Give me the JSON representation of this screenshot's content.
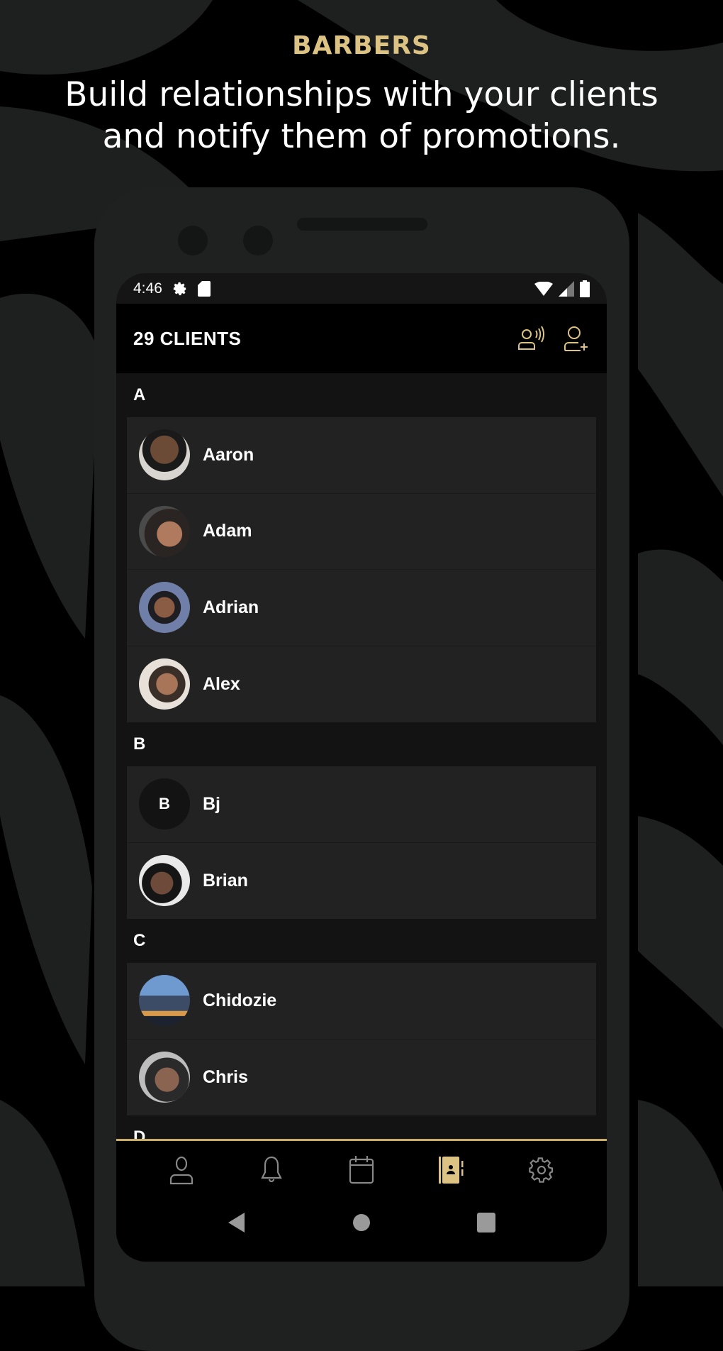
{
  "promo": {
    "tag": "BARBERS",
    "headline_line1": "Build relationships with your clients",
    "headline_line2": "and notify them of promotions."
  },
  "colors": {
    "accent": "#dcc383",
    "background": "#1e1f1f",
    "card": "#222222",
    "section": "#131313"
  },
  "status": {
    "time": "4:46",
    "icons": [
      "gear-icon",
      "sd-card-icon",
      "wifi-icon",
      "signal-icon",
      "battery-icon"
    ]
  },
  "appbar": {
    "title": "29 CLIENTS",
    "actions": [
      "broadcast-client-icon",
      "add-client-icon"
    ]
  },
  "sections": [
    {
      "letter": "A",
      "clients": [
        {
          "name": "Aaron"
        },
        {
          "name": "Adam"
        },
        {
          "name": "Adrian"
        },
        {
          "name": "Alex"
        }
      ]
    },
    {
      "letter": "B",
      "clients": [
        {
          "name": "Bj",
          "initial": "B"
        },
        {
          "name": "Brian"
        }
      ]
    },
    {
      "letter": "C",
      "clients": [
        {
          "name": "Chidozie"
        },
        {
          "name": "Chris"
        }
      ]
    },
    {
      "letter": "D"
    }
  ],
  "bottom_nav": {
    "items": [
      "profile",
      "notifications",
      "calendar",
      "clients",
      "settings"
    ],
    "active": "clients"
  }
}
